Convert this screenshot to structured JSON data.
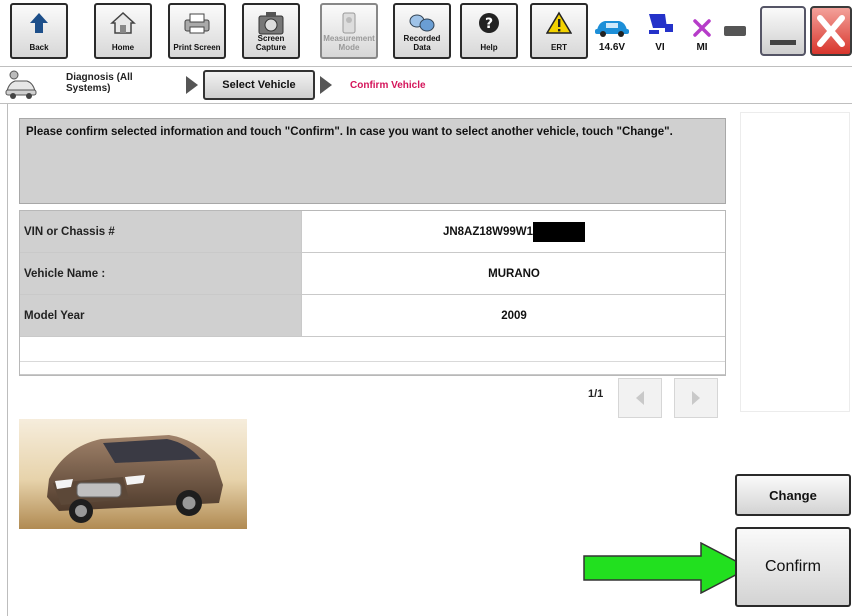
{
  "toolbar": {
    "buttons": [
      {
        "label": "Back",
        "icon": "back-arrow-icon"
      },
      {
        "label": "Home",
        "icon": "home-icon"
      },
      {
        "label": "Print Screen",
        "icon": "printer-icon"
      },
      {
        "label": "Screen Capture",
        "icon": "camera-icon"
      },
      {
        "label": "Measurement Mode",
        "icon": "measurement-icon",
        "disabled": true
      },
      {
        "label": "Recorded Data",
        "icon": "recorded-data-icon"
      },
      {
        "label": "Help",
        "icon": "help-icon"
      },
      {
        "label": "ERT",
        "icon": "warning-icon"
      }
    ],
    "status": [
      {
        "label": "14.6V",
        "icon": "car-battery-icon"
      },
      {
        "label": "VI",
        "icon": "vi-interface-icon"
      },
      {
        "label": "MI",
        "icon": "mi-disconnected-icon"
      }
    ]
  },
  "breadcrumb": {
    "step1": "Diagnosis (All Systems)",
    "step2": "Select Vehicle",
    "step3": "Confirm Vehicle"
  },
  "main": {
    "message": "Please confirm selected information and touch \"Confirm\". In case you want to select another vehicle, touch \"Change\".",
    "vehicle_rows": [
      {
        "label": "VIN or Chassis #",
        "value": "JN8AZ18W99W1"
      },
      {
        "label": "Vehicle Name :",
        "value": "MURANO"
      },
      {
        "label": "Model Year",
        "value": "2009"
      }
    ],
    "page_indicator": "1/1",
    "change_label": "Change",
    "confirm_label": "Confirm"
  },
  "colors": {
    "accent_text": "#d4145a",
    "arrow_green": "#22e01f",
    "panel_gray": "#d0d0d0"
  }
}
